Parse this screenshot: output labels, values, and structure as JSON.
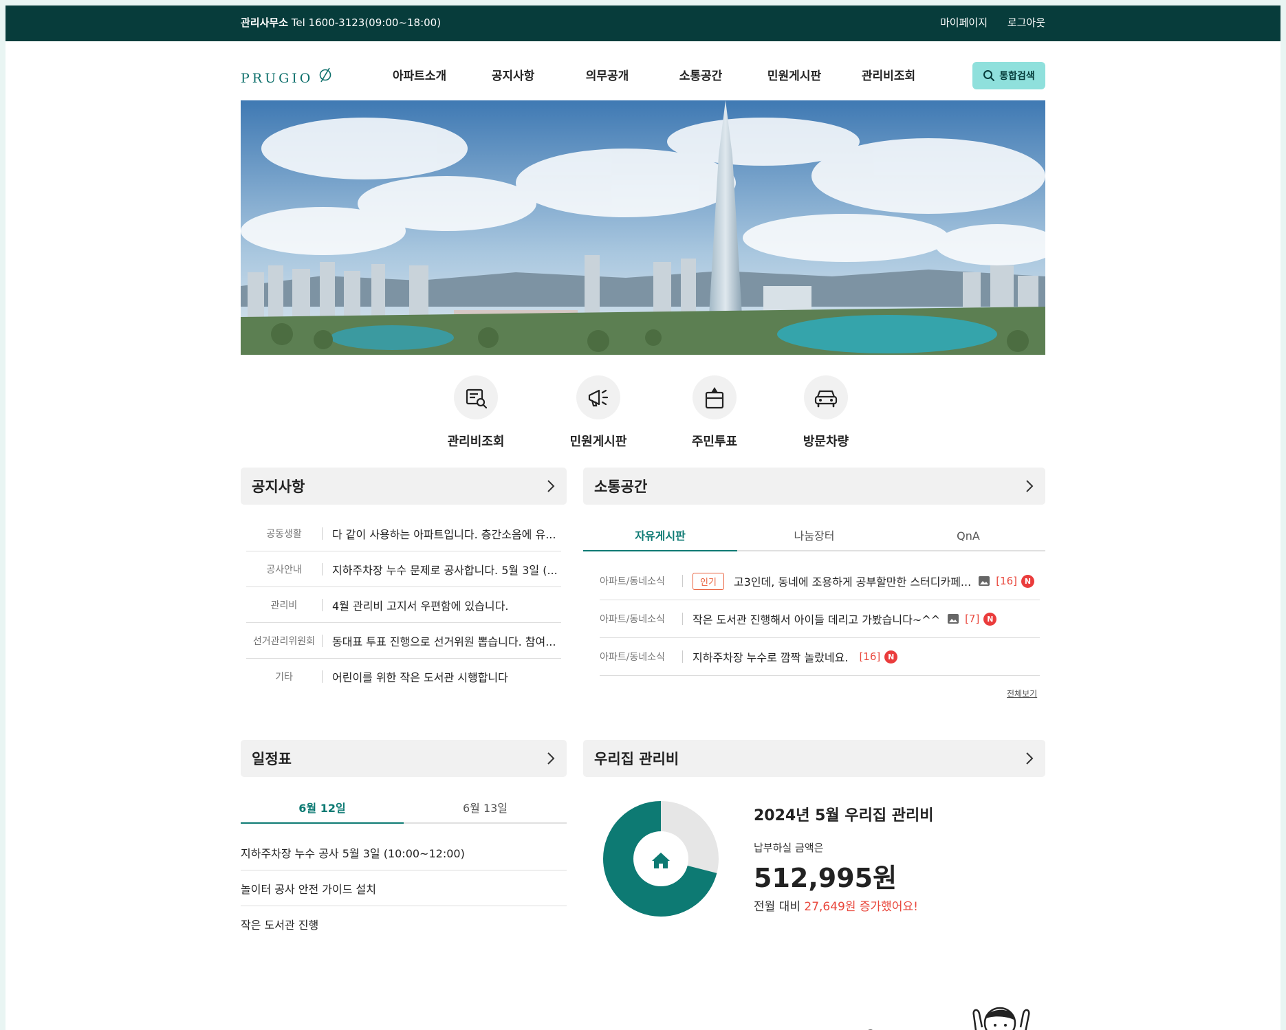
{
  "topbar": {
    "office_label": "관리사무소",
    "office_tel": "Tel 1600-3123(09:00~18:00)",
    "mypage": "마이페이지",
    "logout": "로그아웃"
  },
  "header": {
    "logo_text": "PRUGIO",
    "nav": [
      "아파트소개",
      "공지사항",
      "의무공개",
      "소통공간",
      "민원게시판",
      "관리비조회"
    ],
    "search_label": "통합검색"
  },
  "quick_menu": [
    {
      "label": "관리비조회",
      "icon": "bill-search-icon"
    },
    {
      "label": "민원게시판",
      "icon": "megaphone-icon"
    },
    {
      "label": "주민투표",
      "icon": "ballot-box-icon"
    },
    {
      "label": "방문차량",
      "icon": "car-icon"
    }
  ],
  "notice": {
    "title": "공지사항",
    "items": [
      {
        "category": "공동생활",
        "text": "다 같이 사용하는 아파트입니다. 층간소음에 유..."
      },
      {
        "category": "공사안내",
        "text": "지하주차장 누수 문제로 공사합니다. 5월 3일 (..."
      },
      {
        "category": "관리비",
        "text": "4월 관리비 고지서 우편함에 있습니다."
      },
      {
        "category": "선거관리위원회",
        "text": "동대표 투표 진행으로 선거위원 뽑습니다. 참여..."
      },
      {
        "category": "기타",
        "text": "어린이를 위한 작은 도서관 시행합니다"
      }
    ]
  },
  "community": {
    "title": "소통공간",
    "tabs": [
      "자유게시판",
      "나눔장터",
      "QnA"
    ],
    "active_tab": "자유게시판",
    "posts": [
      {
        "category": "아파트/동네소식",
        "badge": "인기",
        "title": "고3인데, 동네에 조용하게 공부할만한 스터디카페...",
        "has_image": true,
        "count": "[16]",
        "new": "N"
      },
      {
        "category": "아파트/동네소식",
        "badge": "",
        "title": "작은 도서관 진행해서 아이들 데리고 가봤습니다~^^",
        "has_image": true,
        "count": "[7]",
        "new": "N"
      },
      {
        "category": "아파트/동네소식",
        "badge": "",
        "title": "지하주차장 누수로 깜짝 놀랐네요.",
        "has_image": false,
        "count": "[16]",
        "new": "N"
      }
    ],
    "view_all": "전체보기"
  },
  "schedule": {
    "title": "일정표",
    "tabs": [
      "6월 12일",
      "6월 13일"
    ],
    "active_tab": "6월 12일",
    "items": [
      "지하주차장 누수 공사 5월 3일 (10:00~12:00)",
      "놀이터 공사 안전 가이드 설치",
      "작은 도서관 진행"
    ]
  },
  "fee": {
    "title": "우리집 관리비",
    "heading": "2024년 5월 우리집 관리비",
    "amount_label": "납부하실 금액은",
    "amount": "512,995원",
    "compare_prefix": "전월 대비",
    "compare_value": "27,649원 증가했어요!",
    "chart_share": 0.71
  },
  "colors": {
    "brand": "#0d7a73",
    "topbar": "#073c3b",
    "search_bg": "#8fe0dc",
    "alert": "#e9473c"
  }
}
